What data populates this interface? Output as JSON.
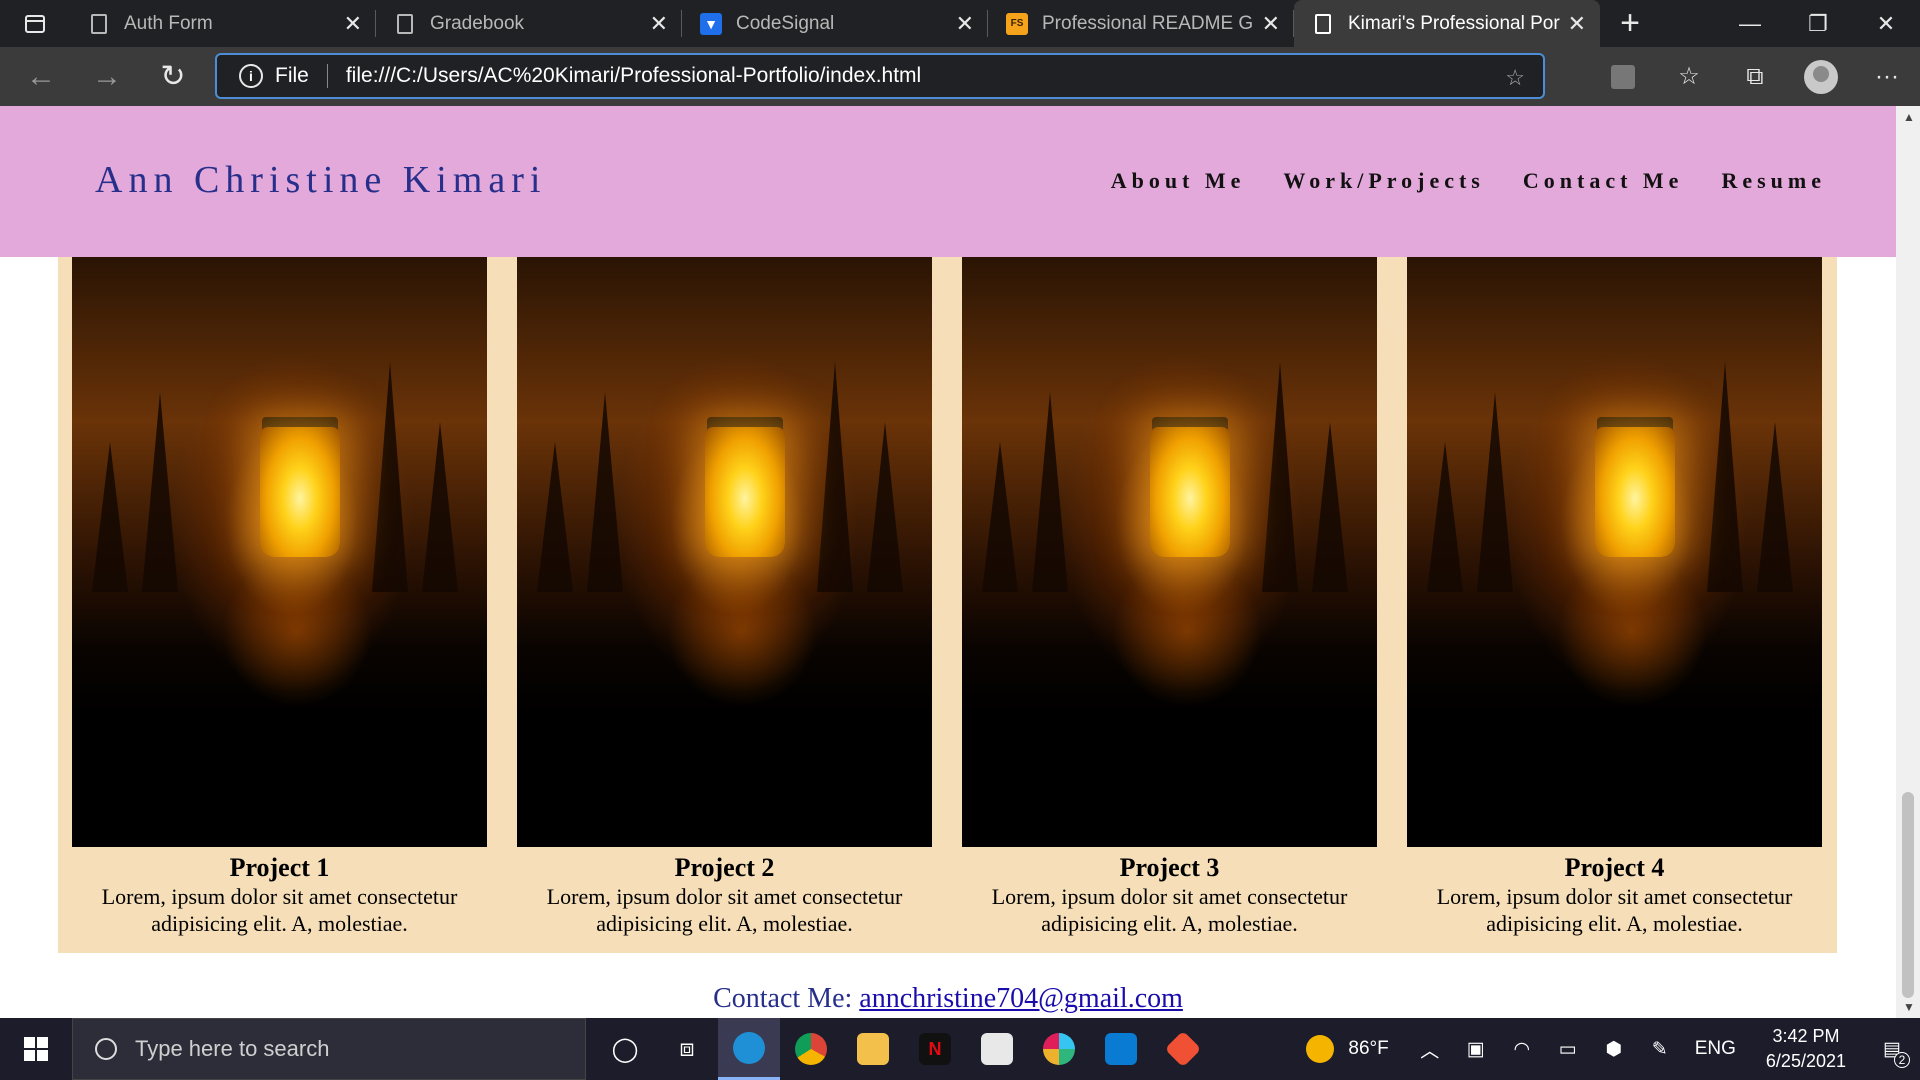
{
  "browser": {
    "tabs": [
      {
        "label": "Auth Form",
        "favicon": "document-icon"
      },
      {
        "label": "Gradebook",
        "favicon": "document-icon"
      },
      {
        "label": "CodeSignal",
        "favicon": "codesignal-icon"
      },
      {
        "label": "Professional README Gui",
        "favicon": "fs-icon"
      },
      {
        "label": "Kimari's Professional Portf",
        "favicon": "document-icon",
        "active": true
      }
    ],
    "address": {
      "scheme_label": "File",
      "url": "file:///C:/Users/AC%20Kimari/Professional-Portfolio/index.html"
    }
  },
  "site": {
    "name": "Ann Christine Kimari",
    "nav": [
      "About Me",
      "Work/Projects",
      "Contact Me",
      "Resume"
    ],
    "projects": [
      {
        "title": "Project 1",
        "description": "Lorem, ipsum dolor sit amet consectetur adipisicing elit. A, molestiae."
      },
      {
        "title": "Project 2",
        "description": "Lorem, ipsum dolor sit amet consectetur adipisicing elit. A, molestiae."
      },
      {
        "title": "Project 3",
        "description": "Lorem, ipsum dolor sit amet consectetur adipisicing elit. A, molestiae."
      },
      {
        "title": "Project 4",
        "description": "Lorem, ipsum dolor sit amet consectetur adipisicing elit. A, molestiae."
      }
    ],
    "contact": {
      "label": "Contact Me:",
      "email": "annchristine704@gmail.com"
    },
    "colors": {
      "header_bg": "#e3a9db",
      "projects_bg": "#f5deb8",
      "name_color": "#272f8a"
    }
  },
  "taskbar": {
    "search_placeholder": "Type here to search",
    "weather": "86°F",
    "language": "ENG",
    "time": "3:42 PM",
    "date": "6/25/2021",
    "notifications": "2"
  }
}
